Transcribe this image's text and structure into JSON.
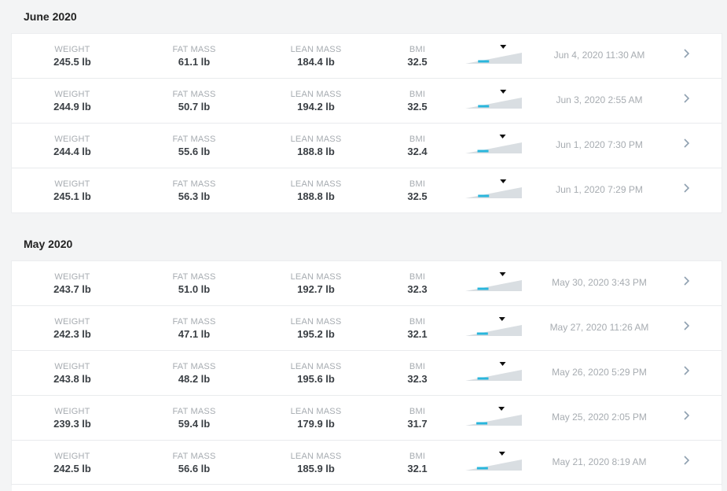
{
  "sections": [
    {
      "title": "June 2020",
      "entries": [
        {
          "weight": "245.5 lb",
          "fat": "61.1 lb",
          "lean": "184.4 lb",
          "bmi": "32.5",
          "bmi_level": 0.42,
          "date": "Jun 4, 2020 11:30 AM"
        },
        {
          "weight": "244.9 lb",
          "fat": "50.7 lb",
          "lean": "194.2 lb",
          "bmi": "32.5",
          "bmi_level": 0.42,
          "date": "Jun 3, 2020 2:55 AM"
        },
        {
          "weight": "244.4 lb",
          "fat": "55.6 lb",
          "lean": "188.8 lb",
          "bmi": "32.4",
          "bmi_level": 0.41,
          "date": "Jun 1, 2020 7:30 PM"
        },
        {
          "weight": "245.1 lb",
          "fat": "56.3 lb",
          "lean": "188.8 lb",
          "bmi": "32.5",
          "bmi_level": 0.42,
          "date": "Jun 1, 2020 7:29 PM"
        }
      ]
    },
    {
      "title": "May 2020",
      "entries": [
        {
          "weight": "243.7 lb",
          "fat": "51.0 lb",
          "lean": "192.7 lb",
          "bmi": "32.3",
          "bmi_level": 0.41,
          "date": "May 30, 2020 3:43 PM"
        },
        {
          "weight": "242.3 lb",
          "fat": "47.1 lb",
          "lean": "195.2 lb",
          "bmi": "32.1",
          "bmi_level": 0.4,
          "date": "May 27, 2020 11:26 AM"
        },
        {
          "weight": "243.8 lb",
          "fat": "48.2 lb",
          "lean": "195.6 lb",
          "bmi": "32.3",
          "bmi_level": 0.41,
          "date": "May 26, 2020 5:29 PM"
        },
        {
          "weight": "239.3 lb",
          "fat": "59.4 lb",
          "lean": "179.9 lb",
          "bmi": "31.7",
          "bmi_level": 0.39,
          "date": "May 25, 2020 2:05 PM"
        },
        {
          "weight": "242.5 lb",
          "fat": "56.6 lb",
          "lean": "185.9 lb",
          "bmi": "32.1",
          "bmi_level": 0.4,
          "date": "May 21, 2020 8:19 AM"
        }
      ]
    }
  ],
  "labels": {
    "weight": "WEIGHT",
    "fat": "FAT MASS",
    "lean": "LEAN MASS",
    "bmi": "BMI"
  },
  "icons": {
    "chevron": "chevron-right-icon",
    "gauge": "bmi-gauge-icon"
  },
  "colors": {
    "gauge_track": "#d9dee2",
    "gauge_fill": "#29b6dc",
    "marker": "#111111"
  }
}
